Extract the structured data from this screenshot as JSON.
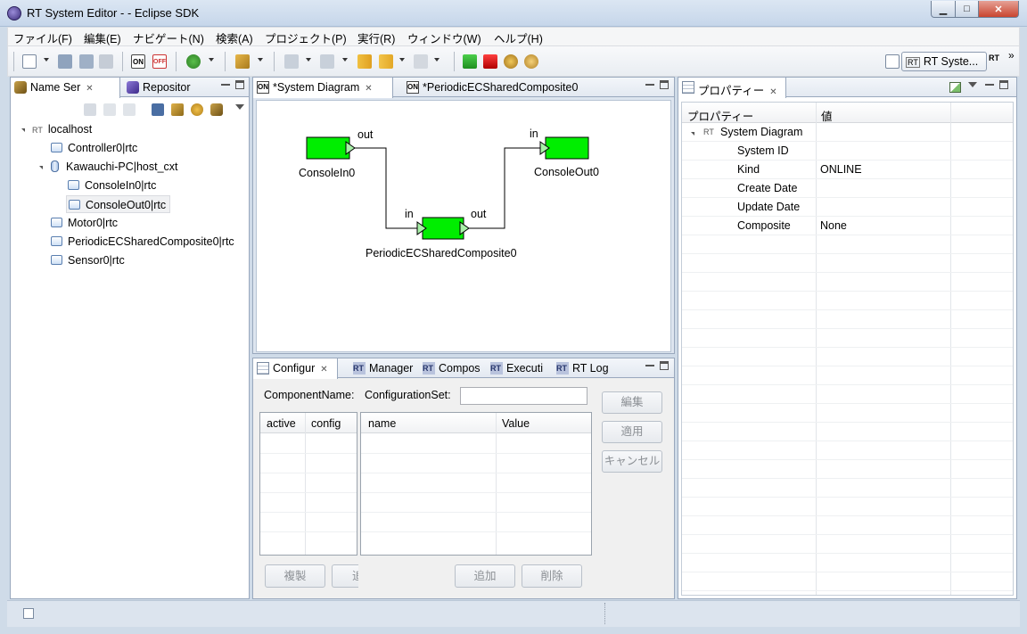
{
  "window": {
    "title": "RT System Editor -  - Eclipse SDK",
    "min": "▁",
    "max": "□",
    "close": "✕"
  },
  "menu": [
    "ファイル(F)",
    "編集(E)",
    "ナビゲート(N)",
    "検索(A)",
    "プロジェクト(P)",
    "実行(R)",
    "ウィンドウ(W)",
    "ヘルプ(H)"
  ],
  "perspective": {
    "label": "RT Syste...",
    "more": "»"
  },
  "left_panel": {
    "tabs": [
      {
        "label": "Name Ser"
      },
      {
        "label": "Repositor"
      }
    ],
    "tree": {
      "root": "localhost",
      "items": [
        {
          "label": "Controller0|rtc"
        },
        {
          "label": "Kawauchi-PC|host_cxt"
        },
        {
          "label": "ConsoleIn0|rtc"
        },
        {
          "label": "ConsoleOut0|rtc"
        },
        {
          "label": "Motor0|rtc"
        },
        {
          "label": "PeriodicECSharedComposite0|rtc"
        },
        {
          "label": "Sensor0|rtc"
        }
      ],
      "root_icon_text": "RT"
    }
  },
  "editor": {
    "tabs": [
      {
        "label": "*System Diagram"
      },
      {
        "label": "*PeriodicECSharedComposite0"
      }
    ],
    "tab_icon_text": "ON",
    "components": [
      {
        "name": "ConsoleIn0",
        "port_out": "out"
      },
      {
        "name": "ConsoleOut0",
        "port_in": "in"
      },
      {
        "name": "PeriodicECSharedComposite0",
        "port_in": "in",
        "port_out": "out"
      }
    ],
    "colors": {
      "component": "#00ee00",
      "port": "#a8f0a8"
    }
  },
  "bottom_panel": {
    "tabs": [
      {
        "label": "Configur"
      },
      {
        "label": "Manager"
      },
      {
        "label": "Compos"
      },
      {
        "label": "Executi"
      },
      {
        "label": "RT Log"
      }
    ],
    "rt_icon_text": "RT",
    "component_name_label": "ComponentName:",
    "configuration_set_label": "ConfigurationSet:",
    "configuration_set_value": "",
    "left_table_headers": [
      "active",
      "config"
    ],
    "right_table_headers": [
      "name",
      "Value"
    ],
    "buttons": {
      "edit": "編集",
      "apply": "適用",
      "cancel": "キャンセル",
      "copy": "複製",
      "add_partial": "追",
      "add": "追加",
      "delete": "削除"
    }
  },
  "properties": {
    "tab": "プロパティー",
    "headers": [
      "プロパティー",
      "値"
    ],
    "group": "System Diagram",
    "group_icon_text": "RT",
    "rows": [
      {
        "key": "System ID",
        "value": ""
      },
      {
        "key": "Kind",
        "value": "ONLINE"
      },
      {
        "key": "Create Date",
        "value": ""
      },
      {
        "key": "Update Date",
        "value": ""
      },
      {
        "key": "Composite",
        "value": "None"
      }
    ]
  },
  "toolbar": {
    "on_icon": "ON",
    "off_icon": "OFF"
  },
  "perspective_icon_text": "RT"
}
